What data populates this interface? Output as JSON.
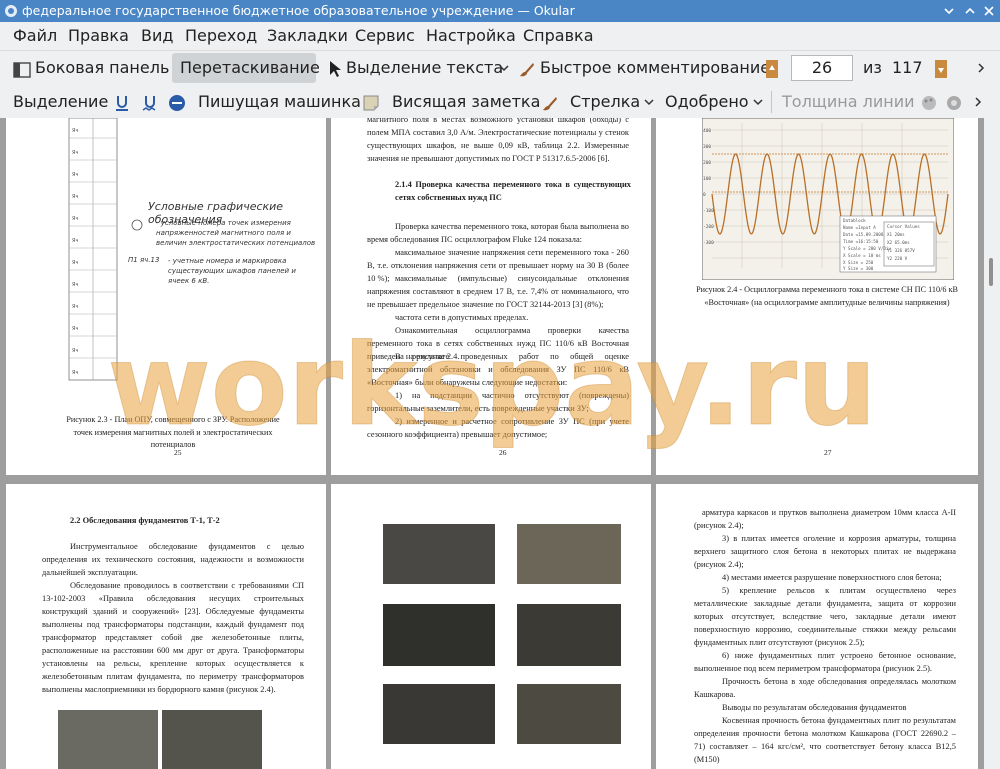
{
  "window": {
    "title": "федеральное государственное бюджетное образовательное учреждение  — Okular"
  },
  "menu": [
    "Файл",
    "Правка",
    "Вид",
    "Переход",
    "Закладки",
    "Сервис",
    "Настройка",
    "Справка"
  ],
  "toolbar1": {
    "sidebar": "Боковая панель",
    "drag": "Перетаскивание",
    "select_text": "Выделение текста",
    "quick_comment": "Быстрое комментирование",
    "page_current": "26",
    "page_of": "из",
    "page_total": "117"
  },
  "toolbar2": {
    "selection": "Выделение",
    "typewriter": "Пишущая машинка",
    "hanging_note": "Висящая заметка",
    "arrow": "Стрелка",
    "approved": "Одобрено",
    "line_width": "Толщина линии"
  },
  "watermark": "workspay.ru",
  "pages": {
    "p25": {
      "number": "25",
      "heading": "Условные графические обозначения",
      "legend": [
        "- условные номера точек измерения напряженностей магнитного поля и величин электростатических потенциалов",
        "- учетные номера и маркировка существующих шкафов панелей и ячеек 6 кВ."
      ],
      "caption": "Рисунок 2.3 - План ОПУ, совмещенного с ЗРУ. Расположение точек измерения магнитных полей и электростатических потенциалов"
    },
    "p26": {
      "number": "26",
      "top_text": "магнитного поля в местах возможного установки шкафов (обходы) с полем МПА составил 3,0 А/м. Электростатические потенциалы у стенок существующих шкафов, не выше 0,09 кВ, таблица 2.2. Измеренные значения не превышают допустимых по ГОСТ Р 51317.6.5-2006 [6].",
      "heading": "2.1.4 Проверка качества переменного тока в существующих сетях собственных нужд ПС",
      "paragraphs": [
        "Проверка качества переменного тока, которая была выполнена во время обследования ПС осциллографом Fluke 124 показала:",
        "максимальное значение напряжения сети переменного тока - 260 В, т.е. отклонения напряжения сети от превышает норму на 30 В (более 10 %);",
        "максимальные (импульсные) синусоидальные отклонения напряжения составляют в среднем 17 В, т.е. 7,4% от номинального, что не превышает предельное значение по ГОСТ 32144-2013 [3] (8%);",
        "частота сети в допустимых пределах.",
        "Ознакомительная осциллограмма проверки качества переменного тока в сетях собственных нужд ПС 110/6 кВ Восточная приведена на рисунке 2.4.",
        "В результате проведенных работ по общей оценке электромагнитной обстановки и обследования ЗУ ПС 110/6 кВ «Восточная» были обнаружены следующие недостатки:",
        "1) на подстанции частично отсутствуют (повреждены) горизонтальные заземлители, есть поврежденные участки ЗУ;",
        "2) измеренное и расчетное сопротивление ЗУ ПС (при учете сезонного коэффициента) превышает допустимое;"
      ]
    },
    "p27": {
      "number": "27",
      "caption": "Рисунок 2.4 - Осциллограмма переменного тока в системе СН ПС 110/6 кВ «Восточная» (на осциллограмме амплитудные величины напряжения)"
    },
    "p28": {
      "heading": "2.2 Обследования фундаментов Т-1, Т-2",
      "paragraphs": [
        "Инструментальное обследование фундаментов с целью определения их технического состояния, надежности и возможности дальнейшей эксплуатации.",
        "Обследование проводилось в соответствии с требованиями СП 13-102-2003 «Правила обследования несущих строительных конструкций зданий и сооружений» [23]. Обследуемые фундаменты выполнены под трансформаторы подстанции, каждый фундамент под трансформатор представляет собой две железобетонные плиты, расположенные на расстоянии 600 мм друг от друга. Трансформаторы установлены на рельсы, крепление которых осуществляется к железобетонным плитам фундамента, по периметру трансформаторов выполнены маслоприемники из бордюрного камня (рисунок 2.4)."
      ]
    },
    "p30": {
      "lines": [
        "арматура каркасов и прутков выполнена диаметром 10мм класса А-II (рисунок 2.4);",
        "3) в плитах имеется оголение и коррозия арматуры, толщина верхнего защитного слоя бетона в некоторых плитах не выдержана (рисунок 2.4);",
        "4) местами имеется разрушение поверхностного слоя бетона;",
        "5) крепление рельсов к плитам осуществлено через металлические закладные детали фундамента, защита от коррозии которых отсутствует, вследствие чего, закладные детали имеют поверхностную коррозию, соединительные стяжки между рельсами фундаментных плит отсутствуют (рисунок 2.5);",
        "6) ниже фундаментных плит устроено бетонное основание, выполненное под всем периметром трансформатора (рисунок 2.5).",
        "Прочность бетона в ходе обследования определялась молотком Кашкарова.",
        "Выводы по результатам обследования фундаментов",
        "Косвенная прочность бетона фундаментных плит по результатам определения прочности бетона молотком Кашкарова (ГОСТ 22690.2 – 71) составляет – 164 кгс/см², что соответствует бетону класса В12,5 (М150)"
      ]
    }
  },
  "colors": {
    "titlebar": "#4a86c5",
    "toolbar": "#eff0f1",
    "watermark": "#e8a23c"
  }
}
